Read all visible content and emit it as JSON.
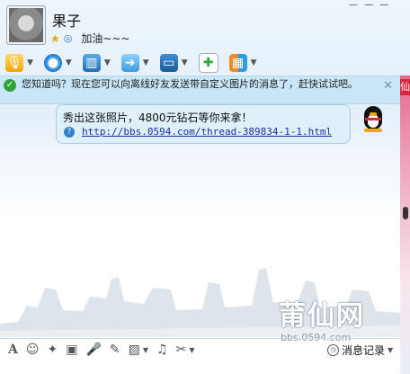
{
  "contact": {
    "nickname": "果子",
    "signature": "加油~~~"
  },
  "header": {
    "top_dash": "— — —"
  },
  "toolbar": {
    "items": [
      {
        "name": "voice",
        "icon": "microphone-icon"
      },
      {
        "name": "video",
        "icon": "webcam-icon"
      },
      {
        "name": "remote",
        "icon": "remote-desktop-icon"
      },
      {
        "name": "file",
        "icon": "folder-transfer-icon"
      },
      {
        "name": "screen",
        "icon": "screen-share-icon"
      },
      {
        "name": "message",
        "icon": "add-message-icon"
      },
      {
        "name": "apps",
        "icon": "apps-grid-icon"
      }
    ]
  },
  "tip": {
    "text": "您知道吗？现在您可以向离线好友发送带自定义图片的消息了，赶快试试吧。"
  },
  "message": {
    "text": "秀出这张照片，4800元钻石等你来拿！",
    "link": "http://bbs.0594.com/thread-389834-1-1.html"
  },
  "background": {
    "watermark": "莆仙网",
    "watermark_url": "bbs.0594.com"
  },
  "ad": {
    "visible_char": "仙"
  },
  "input_toolbar": {
    "history_label": "消息记录"
  },
  "colors": {
    "tip_bg": "#c8e6f7",
    "bubble_bg": "#dff0fb",
    "link": "#1a2fa8"
  }
}
